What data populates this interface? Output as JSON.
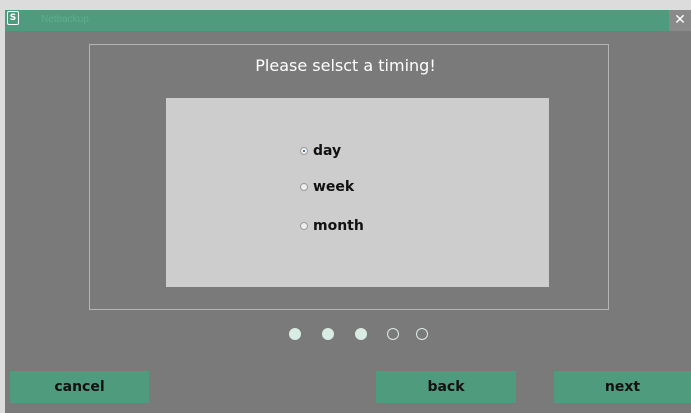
{
  "window": {
    "title": "Netbackup",
    "close_glyph": "✕",
    "app_icon": "app-logo-icon"
  },
  "dialog": {
    "heading": "Please selsct a timing!",
    "options": [
      {
        "label": "day",
        "selected": true
      },
      {
        "label": "week",
        "selected": false
      },
      {
        "label": "month",
        "selected": false
      }
    ]
  },
  "pager": {
    "steps": 5,
    "current_step": 3
  },
  "buttons": {
    "cancel": "cancel",
    "back": "back",
    "next": "next"
  },
  "colors": {
    "accent": "#4f9b7e",
    "background": "#7a7a7a",
    "panel": "#cdcdcd"
  }
}
